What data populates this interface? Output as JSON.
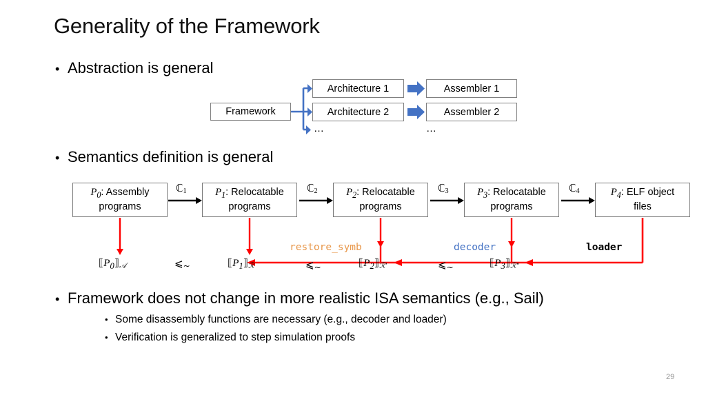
{
  "slide": {
    "title": "Generality of the Framework",
    "page_number": "29"
  },
  "bullets": {
    "abstraction": "Abstraction is general",
    "semantics": "Semantics definition is general",
    "framework": "Framework does not change in more realistic ISA semantics (e.g., Sail)",
    "sub_disassembly": "Some disassembly functions are necessary (e.g., decoder and loader)",
    "sub_verification": "Verification is generalized to step simulation proofs"
  },
  "bullet_marker": "•",
  "architecture_diagram": {
    "framework_box": "Framework",
    "architecture_1": "Architecture 1",
    "architecture_2": "Architecture 2",
    "assembler_1": "Assembler 1",
    "assembler_2": "Assembler 2",
    "ellipsis_architecture": "…",
    "ellipsis_assembler": "…",
    "arrow_color": "#4472C4",
    "box_border_color": "#808080"
  },
  "chain_diagram": {
    "boxes": [
      {
        "var": "P",
        "index": "0",
        "line1": ": Assembly",
        "line2": "programs"
      },
      {
        "var": "P",
        "index": "1",
        "line1": ": Relocatable",
        "line2": "programs"
      },
      {
        "var": "P",
        "index": "2",
        "line1": ": Relocatable",
        "line2": "programs"
      },
      {
        "var": "P",
        "index": "3",
        "line1": ": Relocatable",
        "line2": "programs"
      },
      {
        "var": "P",
        "index": "4",
        "line1": ": ELF object",
        "line2": "files"
      }
    ],
    "compiler_labels": [
      {
        "symbol": "ℂ",
        "index": "1"
      },
      {
        "symbol": "ℂ",
        "index": "2"
      },
      {
        "symbol": "ℂ",
        "index": "3"
      },
      {
        "symbol": "ℂ",
        "index": "4"
      }
    ],
    "denotations": [
      {
        "open": "⟦",
        "var": "P",
        "index": "0",
        "close": "⟧",
        "sub": "𝒜"
      },
      {
        "open": "⟦",
        "var": "P",
        "index": "1",
        "close": "⟧",
        "sub": "ℛ"
      },
      {
        "open": "⟦",
        "var": "P",
        "index": "2",
        "close": "⟧",
        "sub": "ℛ′"
      },
      {
        "open": "⟦",
        "var": "P",
        "index": "3",
        "close": "⟧",
        "sub": "ℛ″"
      }
    ],
    "relations": [
      {
        "symbol": "⩽",
        "tilde": "~"
      },
      {
        "symbol": "⩽",
        "tilde": "~"
      },
      {
        "symbol": "⩽",
        "tilde": "~"
      }
    ],
    "functions": [
      {
        "name": "restore_symb",
        "color": "#E8974A"
      },
      {
        "name": "decoder",
        "color": "#4472C4"
      },
      {
        "name": "loader",
        "color": "#000000"
      }
    ],
    "red_color": "#FF0000",
    "black_arrow_color": "#000000"
  }
}
